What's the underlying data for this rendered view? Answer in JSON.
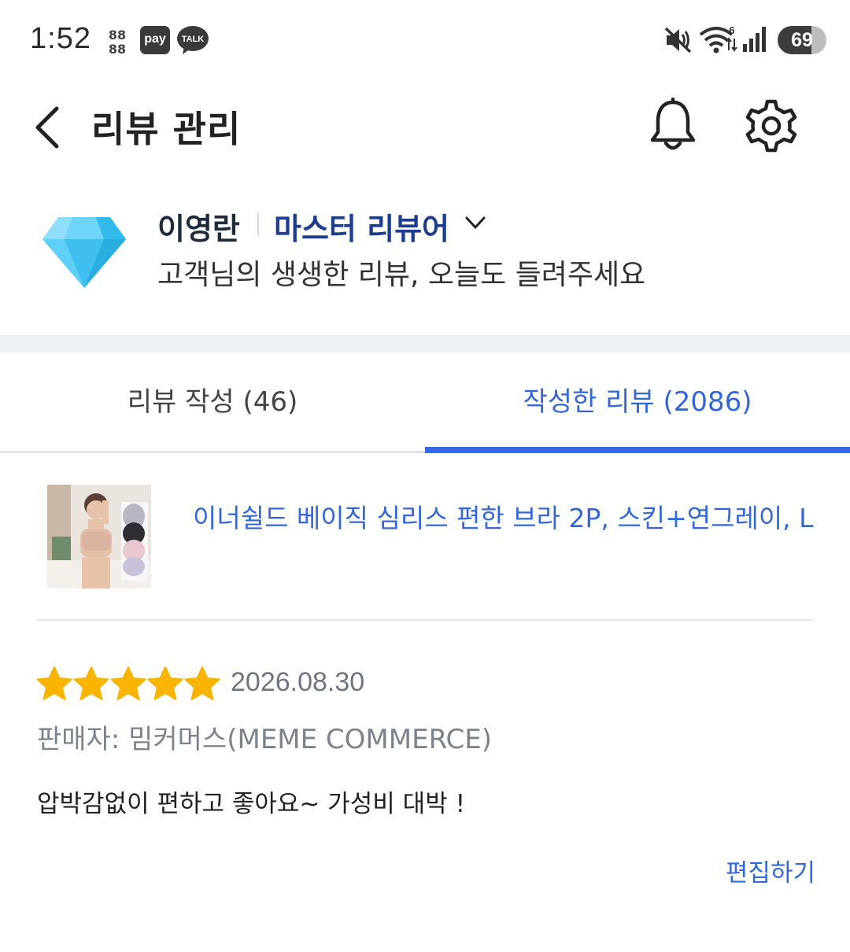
{
  "status_bar": {
    "time": "1:52",
    "notif_88": "88\n88",
    "pay_label": "pay",
    "talk_label": "TALK",
    "wifi_badge": "6",
    "battery_level": "69",
    "battery_fraction": 0.69
  },
  "header": {
    "title": "리뷰 관리"
  },
  "profile": {
    "name": "이영란",
    "grade": "마스터 리뷰어",
    "subtitle": "고객님의 생생한 리뷰, 오늘도 들려주세요"
  },
  "tabs": [
    {
      "label": "리뷰 작성 (46)",
      "active": false
    },
    {
      "label": "작성한 리뷰 (2086)",
      "active": true
    }
  ],
  "review": {
    "product_name": "이너쉴드 베이직 심리스 편한 브라 2P, 스킨+연그레이, L",
    "rating": 5,
    "rating_max": 5,
    "date": "2026.08.30",
    "seller": "판매자: 밈커머스(MEME COMMERCE)",
    "text": "압박감없이 편하고 좋아요~ 가성비 대박 !",
    "edit_label": "편집하기"
  },
  "colors": {
    "accent": "#346aea",
    "link": "#3468d8",
    "grade": "#1f3d8f",
    "star": "#f8b400",
    "diamond": "#4cc9f5"
  }
}
